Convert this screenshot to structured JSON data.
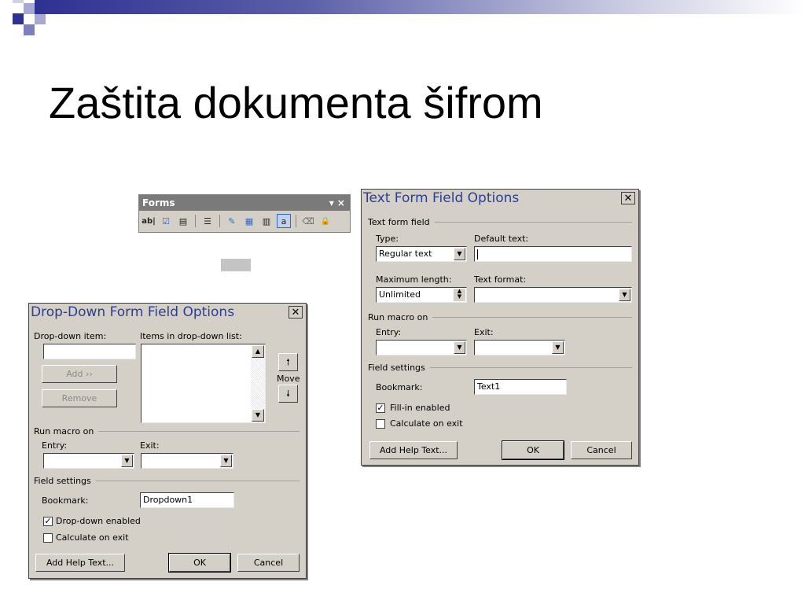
{
  "slide": {
    "title": "Zaštita dokumenta šifrom"
  },
  "colors": {
    "accent": "#2e3192",
    "decor_light": "#9999cc",
    "dialog_bg": "#d4d0c8",
    "title_text": "#2c3e8f"
  },
  "forms_toolbar": {
    "title": "Forms",
    "controls": "▾ ×",
    "buttons": [
      {
        "icon": "text-form-field-icon",
        "glyph": "ab|"
      },
      {
        "icon": "check-box-form-field-icon",
        "glyph": "☑"
      },
      {
        "icon": "drop-down-form-field-icon",
        "glyph": "▤"
      },
      {
        "icon": "form-field-options-icon",
        "glyph": "☰"
      },
      {
        "icon": "draw-table-icon",
        "glyph": "✎"
      },
      {
        "icon": "insert-table-icon",
        "glyph": "▦"
      },
      {
        "icon": "insert-frame-icon",
        "glyph": "▥"
      },
      {
        "icon": "form-field-shading-icon",
        "glyph": "a"
      },
      {
        "icon": "reset-form-fields-icon",
        "glyph": "⌫"
      },
      {
        "icon": "protect-form-icon",
        "glyph": "🔒"
      }
    ]
  },
  "text_dialog": {
    "title": "Text Form Field Options",
    "group_text_form_field": "Text form field",
    "type_label": "Type:",
    "type_value": "Regular text",
    "default_text_label": "Default text:",
    "default_text_value": "",
    "max_length_label": "Maximum length:",
    "max_length_value": "Unlimited",
    "text_format_label": "Text format:",
    "text_format_value": "",
    "group_run_macro": "Run macro on",
    "entry_label": "Entry:",
    "entry_value": "",
    "exit_label": "Exit:",
    "exit_value": "",
    "group_field_settings": "Field settings",
    "bookmark_label": "Bookmark:",
    "bookmark_value": "Text1",
    "fill_in_enabled_label": "Fill-in enabled",
    "fill_in_enabled_checked": true,
    "calculate_on_exit_label": "Calculate on exit",
    "calculate_on_exit_checked": false,
    "add_help_text_label": "Add Help Text...",
    "ok_label": "OK",
    "cancel_label": "Cancel"
  },
  "dropdown_dialog": {
    "title": "Drop-Down Form Field Options",
    "dropdown_item_label": "Drop-down item:",
    "dropdown_item_value": "",
    "items_list_label": "Items in drop-down list:",
    "items": [],
    "add_label": "Add ››",
    "remove_label": "Remove",
    "move_label": "Move",
    "group_run_macro": "Run macro on",
    "entry_label": "Entry:",
    "entry_value": "",
    "exit_label": "Exit:",
    "exit_value": "",
    "group_field_settings": "Field settings",
    "bookmark_label": "Bookmark:",
    "bookmark_value": "Dropdown1",
    "dropdown_enabled_label": "Drop-down enabled",
    "dropdown_enabled_checked": true,
    "calculate_on_exit_label": "Calculate on exit",
    "calculate_on_exit_checked": false,
    "add_help_text_label": "Add Help Text...",
    "ok_label": "OK",
    "cancel_label": "Cancel"
  }
}
